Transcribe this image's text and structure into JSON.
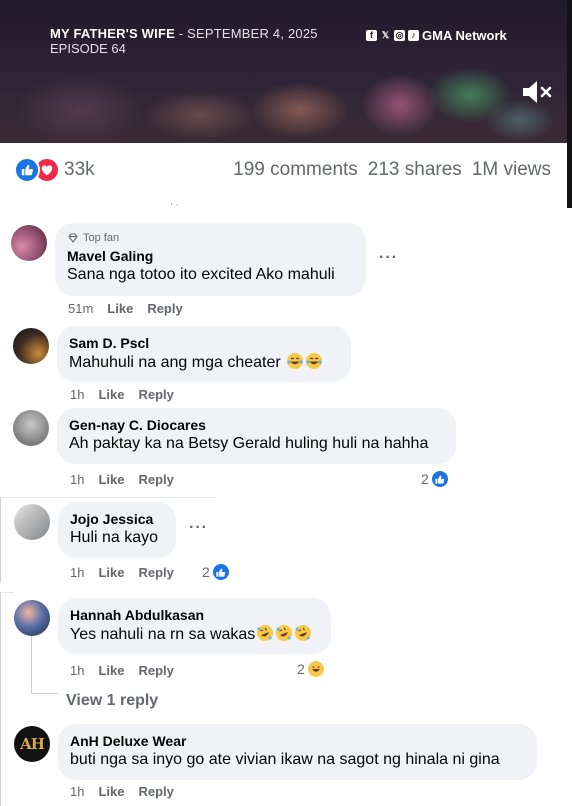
{
  "video": {
    "title": "MY FATHER'S WIFE",
    "date": " - SEPTEMBER 4, 2025",
    "episode": "EPISODE 64",
    "brand": "GMA Network",
    "social_icons": [
      "facebook-icon",
      "x-icon",
      "instagram-icon",
      "tiktok-icon"
    ]
  },
  "stats": {
    "reaction_count": "33k",
    "comments": "199 comments",
    "shares": "213 shares",
    "views": "1M views"
  },
  "labels": {
    "like": "Like",
    "reply": "Reply",
    "top_fan": "Top fan"
  },
  "comments": [
    {
      "name": "Mavel Galing",
      "badge": "Top fan",
      "text": "Sana nga totoo ito excited Ako mahuli",
      "time": "51m"
    },
    {
      "name": "Sam D. Pscl",
      "text": "Mahuhuli na ang mga cheater",
      "emoji": "laughing-tears",
      "emoji_count": 2,
      "time": "1h"
    },
    {
      "name": "Gen-nay C. Diocares",
      "text": "Ah paktay ka na Betsy Gerald huling huli na hahha",
      "time": "1h",
      "reactions": "2"
    },
    {
      "name": "Jojo Jessica",
      "text": "Huli na kayo",
      "time": "1h",
      "reactions": "2"
    },
    {
      "name": "Hannah Abdulkasan",
      "text": "Yes nahuli na rn sa wakas",
      "emoji": "rolling-laughing",
      "emoji_count": 3,
      "time": "1h",
      "reactions": "2"
    },
    {
      "name": "AnH Deluxe Wear",
      "text": "buti nga sa inyo go ate vivian ikaw na sagot ng hinala ni gina",
      "time": "1h"
    }
  ],
  "view_replies": "View 1 reply",
  "colors": {
    "accent": "#1b74e4",
    "love": "#f0284a",
    "bubble": "#f0f2f5",
    "secondary_text": "#65676b"
  }
}
